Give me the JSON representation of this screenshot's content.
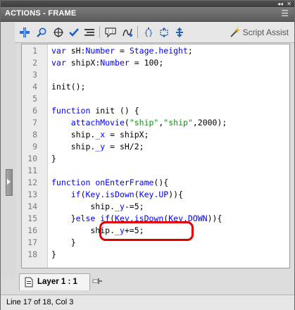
{
  "window": {
    "title": "ACTIONS - FRAME",
    "menu_glyph": "☰",
    "collapse_glyph": "◂◂",
    "close_glyph": "✕"
  },
  "toolbar": {
    "buttons": [
      {
        "icon": "add-statement-icon"
      },
      {
        "icon": "find-icon"
      },
      {
        "icon": "insert-target-path-icon"
      },
      {
        "icon": "check-syntax-icon"
      },
      {
        "icon": "auto-format-icon"
      },
      {
        "icon": "show-code-hint-icon"
      },
      {
        "icon": "debug-options-icon"
      },
      {
        "icon": "collapse-between-braces-icon"
      },
      {
        "icon": "collapse-selection-icon"
      },
      {
        "icon": "expand-all-icon"
      }
    ],
    "script_assist_label": "Script Assist"
  },
  "code_lines": [
    {
      "num": "1",
      "tokens": [
        [
          "kw",
          "var"
        ],
        [
          "txt",
          " sH:"
        ],
        [
          "kw",
          "Number"
        ],
        [
          "txt",
          " = "
        ],
        [
          "kw",
          "Stage.height"
        ],
        [
          "txt",
          ";"
        ]
      ]
    },
    {
      "num": "2",
      "tokens": [
        [
          "kw",
          "var"
        ],
        [
          "txt",
          " shipX:"
        ],
        [
          "kw",
          "Number"
        ],
        [
          "txt",
          " = 100;"
        ]
      ]
    },
    {
      "num": "3",
      "tokens": []
    },
    {
      "num": "4",
      "tokens": [
        [
          "txt",
          "init();"
        ]
      ]
    },
    {
      "num": "5",
      "tokens": []
    },
    {
      "num": "6",
      "tokens": [
        [
          "kw",
          "function"
        ],
        [
          "txt",
          " init () {"
        ]
      ]
    },
    {
      "num": "7",
      "tokens": [
        [
          "txt",
          "    "
        ],
        [
          "kw",
          "attachMovie"
        ],
        [
          "txt",
          "("
        ],
        [
          "str",
          "\"ship\""
        ],
        [
          "txt",
          ","
        ],
        [
          "str",
          "\"ship\""
        ],
        [
          "txt",
          ",2000);"
        ]
      ]
    },
    {
      "num": "8",
      "tokens": [
        [
          "txt",
          "    ship."
        ],
        [
          "kw",
          "_x"
        ],
        [
          "txt",
          " = shipX;"
        ]
      ]
    },
    {
      "num": "9",
      "tokens": [
        [
          "txt",
          "    ship."
        ],
        [
          "kw",
          "_y"
        ],
        [
          "txt",
          " = sH/2;"
        ]
      ]
    },
    {
      "num": "10",
      "tokens": [
        [
          "txt",
          "}"
        ]
      ]
    },
    {
      "num": "11",
      "tokens": []
    },
    {
      "num": "12",
      "tokens": [
        [
          "kw",
          "function"
        ],
        [
          "txt",
          " "
        ],
        [
          "kw",
          "onEnterFrame"
        ],
        [
          "txt",
          "(){"
        ]
      ]
    },
    {
      "num": "13",
      "tokens": [
        [
          "txt",
          "    "
        ],
        [
          "kw",
          "if"
        ],
        [
          "txt",
          "("
        ],
        [
          "kw",
          "Key.isDown"
        ],
        [
          "txt",
          "("
        ],
        [
          "kw",
          "Key.UP"
        ],
        [
          "txt",
          ")){"
        ]
      ]
    },
    {
      "num": "14",
      "tokens": [
        [
          "txt",
          "        ship."
        ],
        [
          "kw",
          "_y"
        ],
        [
          "txt",
          "-=5;"
        ]
      ]
    },
    {
      "num": "15",
      "tokens": [
        [
          "txt",
          "    }"
        ],
        [
          "kw",
          "else if"
        ],
        [
          "txt",
          "("
        ],
        [
          "kw",
          "Key.isDown"
        ],
        [
          "txt",
          "("
        ],
        [
          "kw",
          "Key.DOWN"
        ],
        [
          "txt",
          ")){"
        ]
      ]
    },
    {
      "num": "16",
      "tokens": [
        [
          "txt",
          "        ship."
        ],
        [
          "kw",
          "_y"
        ],
        [
          "txt",
          "+=5;"
        ]
      ]
    },
    {
      "num": "17",
      "tokens": [
        [
          "txt",
          "    }"
        ]
      ]
    },
    {
      "num": "18",
      "tokens": [
        [
          "txt",
          "}"
        ]
      ]
    }
  ],
  "tabs": [
    {
      "label": "Layer 1 : 1",
      "icon": "layer-icon",
      "pin_icon": "pin-icon"
    }
  ],
  "status": {
    "text": "Line 17 of 18, Col 3"
  },
  "colors": {
    "keyword": "#0000ff",
    "string": "#009900",
    "highlight_box": "#e00000"
  }
}
